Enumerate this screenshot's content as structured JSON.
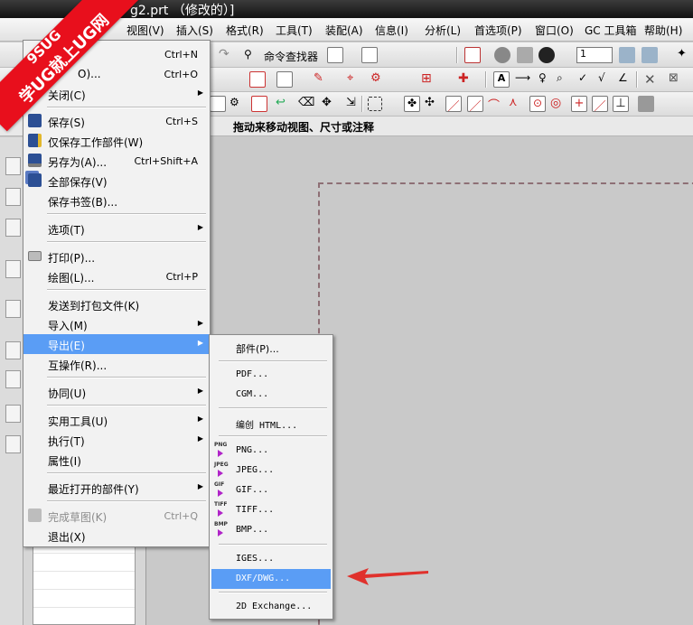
{
  "window": {
    "title": "g2.prt （修改的）]"
  },
  "menubar": {
    "items": [
      "视图(V)",
      "插入(S)",
      "格式(R)",
      "工具(T)",
      "装配(A)",
      "信息(I)",
      "分析(L)",
      "首选项(P)",
      "窗口(O)",
      "GC 工具箱",
      "帮助(H)"
    ]
  },
  "toolbar": {
    "command_finder": "命令查找器",
    "layer_value": "1"
  },
  "cue_line": {
    "text": "拖动来移动视图、尺寸或注释"
  },
  "file_menu": {
    "items": [
      {
        "label": "...",
        "shortcut": "Ctrl+N"
      },
      {
        "label": "O)...",
        "shortcut": "Ctrl+O"
      },
      {
        "label": "关闭(C)",
        "shortcut": ""
      },
      {
        "label": "保存(S)",
        "shortcut": "Ctrl+S"
      },
      {
        "label": "仅保存工作部件(W)",
        "shortcut": ""
      },
      {
        "label": "另存为(A)...",
        "shortcut": "Ctrl+Shift+A"
      },
      {
        "label": "全部保存(V)",
        "shortcut": ""
      },
      {
        "label": "保存书签(B)...",
        "shortcut": ""
      },
      {
        "label": "选项(T)",
        "shortcut": ""
      },
      {
        "label": "打印(P)...",
        "shortcut": ""
      },
      {
        "label": "绘图(L)...",
        "shortcut": "Ctrl+P"
      },
      {
        "label": "发送到打包文件(K)",
        "shortcut": ""
      },
      {
        "label": "导入(M)",
        "shortcut": ""
      },
      {
        "label": "导出(E)",
        "shortcut": ""
      },
      {
        "label": "互操作(R)...",
        "shortcut": ""
      },
      {
        "label": "协同(U)",
        "shortcut": ""
      },
      {
        "label": "实用工具(U)",
        "shortcut": ""
      },
      {
        "label": "执行(T)",
        "shortcut": ""
      },
      {
        "label": "属性(I)",
        "shortcut": ""
      },
      {
        "label": "最近打开的部件(Y)",
        "shortcut": ""
      },
      {
        "label": "完成草图(K)",
        "shortcut": "Ctrl+Q"
      },
      {
        "label": "退出(X)",
        "shortcut": ""
      }
    ]
  },
  "export_submenu": {
    "items": [
      {
        "label": "部件(P)...",
        "badge": ""
      },
      {
        "label": "PDF...",
        "badge": ""
      },
      {
        "label": "CGM...",
        "badge": ""
      },
      {
        "label": "编创 HTML...",
        "badge": ""
      },
      {
        "label": "PNG...",
        "badge": "PNG"
      },
      {
        "label": "JPEG...",
        "badge": "JPEG"
      },
      {
        "label": "GIF...",
        "badge": "GIF"
      },
      {
        "label": "TIFF...",
        "badge": "TIFF"
      },
      {
        "label": "BMP...",
        "badge": "BMP"
      },
      {
        "label": "IGES...",
        "badge": ""
      },
      {
        "label": "DXF/DWG...",
        "badge": ""
      },
      {
        "label": "2D Exchange...",
        "badge": ""
      }
    ]
  },
  "watermark": {
    "line1": "9SUG",
    "line2": "学UG就上UG网"
  },
  "colors": {
    "highlight": "#5a9df5",
    "arrow": "#e0312c",
    "watermark": "#e80f1c"
  }
}
